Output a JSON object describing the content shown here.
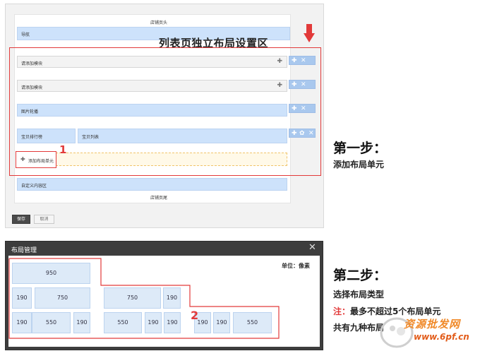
{
  "shop_editor": {
    "header_label": "店铺页头",
    "nav_label": "导航",
    "area_title": "列表页独立布局设置区",
    "modules": [
      {
        "label": "请添加模块"
      },
      {
        "label": "请添加模块"
      },
      {
        "label": "图片轮播"
      }
    ],
    "rank_label": "宝贝排行榜",
    "list_label": "宝贝列表",
    "add_unit_label": "添加布局单元",
    "step_marker_1": "1",
    "custom_area_label": "自定义内容区",
    "footer_label": "店铺页尾",
    "save_label": "保存",
    "cancel_label": "取消",
    "controls": {
      "move": "✚",
      "close": "✕",
      "gear": "✿",
      "plus": "✚"
    }
  },
  "step1": {
    "title": "第一步：",
    "desc": "添加布局单元"
  },
  "dialog": {
    "title": "布局管理",
    "close": "✕",
    "unit_label": "单位：像素",
    "step_marker_2": "2",
    "layouts": {
      "full": "950",
      "left_190_750": [
        "190",
        "750"
      ],
      "three_190_550_190": [
        "190",
        "550",
        "190"
      ],
      "right_750_190": [
        "750",
        "190"
      ],
      "three_550_190_190": [
        "550",
        "190",
        "190"
      ],
      "three_190_190_550": [
        "190",
        "190",
        "550"
      ]
    }
  },
  "step2": {
    "title": "第二步：",
    "desc": "选择布局类型",
    "note_label": "注：",
    "note_text": "最多不超过5个布局单元",
    "total_text": "共有九种布局"
  },
  "watermark": {
    "text1": "资源批发网",
    "text2": "www.6pf.cn"
  },
  "colors": {
    "accent_red": "#e23a3a",
    "bar_blue": "#cde2fb",
    "control_blue": "#a9c8ee",
    "dialog_dark": "#3d3d3d"
  }
}
